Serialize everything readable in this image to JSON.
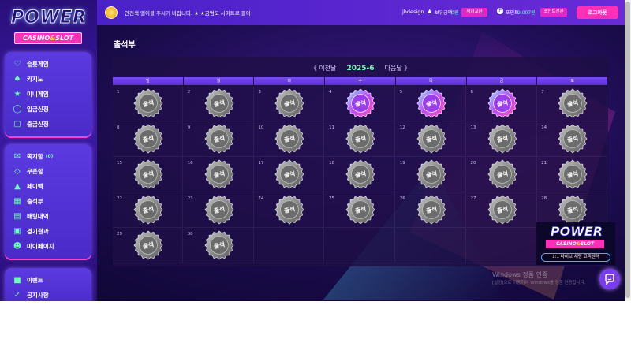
{
  "logo": {
    "title": "POWER",
    "subtitle_left": "CASINO",
    "subtitle_amp": "&",
    "subtitle_right": "SLOT"
  },
  "sidebar": {
    "group1": [
      {
        "label": "슬롯게임",
        "icon": "slot-icon"
      },
      {
        "label": "카지노",
        "icon": "casino-icon"
      },
      {
        "label": "미니게임",
        "icon": "minigame-icon"
      },
      {
        "label": "입금신청",
        "icon": "deposit-icon"
      },
      {
        "label": "출금신청",
        "icon": "withdraw-icon"
      }
    ],
    "group2": [
      {
        "label": "쪽지함",
        "icon": "mail-icon",
        "badge": "(0)"
      },
      {
        "label": "쿠폰함",
        "icon": "coupon-icon"
      },
      {
        "label": "페이백",
        "icon": "payback-icon"
      },
      {
        "label": "출석부",
        "icon": "attendance-icon"
      },
      {
        "label": "배팅내역",
        "icon": "betting-history-icon"
      },
      {
        "label": "경기결과",
        "icon": "results-icon"
      },
      {
        "label": "마이페이지",
        "icon": "user-icon"
      }
    ],
    "group3": [
      {
        "label": "이벤트",
        "icon": "gift-icon"
      },
      {
        "label": "공지사항",
        "icon": "notice-icon"
      }
    ]
  },
  "topbar": {
    "notice": "안전색 엘이블 주시기 바랍니다. ★ ★금범도 사이트로 들이",
    "username": "jhdesign",
    "balance_label": "보유금액",
    "balance_value": "0원",
    "balance_button": "재화교환",
    "point_label": "포인트",
    "point_value": "9,007원",
    "point_button": "포인트전환",
    "logout": "로그아웃"
  },
  "page": {
    "title": "출석부"
  },
  "calendar": {
    "prev": "《 이전달",
    "current": "2025-6",
    "next": "다음달 》",
    "weekdays": [
      "일",
      "월",
      "화",
      "수",
      "목",
      "금",
      "토"
    ],
    "stamp_text": "출석",
    "first_weekday": 0,
    "days_in_month": 30,
    "attended_days": [
      4,
      5,
      6
    ]
  },
  "promo": {
    "title": "POWER",
    "subtitle_left": "CASINO",
    "subtitle_amp": "&",
    "subtitle_right": "SLOT",
    "bar": "1:1 라이브 채팅 고객센터"
  },
  "watermark": {
    "line1": "Windows 정품 인증",
    "line2": "[설정]으로 이동하여 Windows를 정품 인증합니다."
  },
  "colors": {
    "accent": "#ff2fb8",
    "highlight": "#6dffb4",
    "sidebar": "#3b1aa5",
    "background": "#1a0b4a"
  }
}
